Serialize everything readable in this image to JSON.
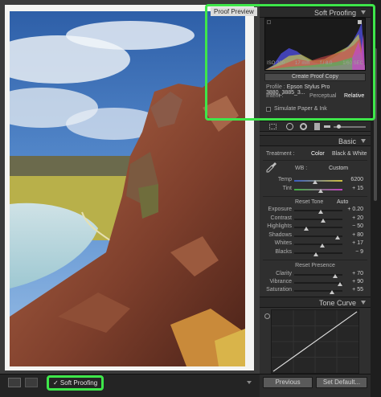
{
  "preview": {
    "proof_preview_label": "Proof Preview"
  },
  "soft_proofing_panel": {
    "title": "Soft Proofing",
    "histogram_info": {
      "iso": "ISO 200",
      "focal_length": "17 mm",
      "aperture": "f / 8.0",
      "shutter": "1/60 SEC"
    },
    "create_proof_copy": "Create Proof Copy",
    "profile_label": "Profile :",
    "profile_value": "Epson Stylus Pro 3880_3885_3...",
    "intent_label": "Intent :",
    "intent_options": [
      "Perceptual",
      "Relative"
    ],
    "intent_selected": "Relative",
    "simulate_label": "Simulate Paper & Ink"
  },
  "basic_panel": {
    "title": "Basic",
    "treatment_label": "Treatment :",
    "treatment_options": [
      "Color",
      "Black & White"
    ],
    "wb_label": "WB :",
    "wb_value": "Custom",
    "temp": {
      "label": "Temp",
      "value": "6200"
    },
    "tint": {
      "label": "Tint",
      "value": "+ 15"
    },
    "reset_tone_label": "Reset Tone",
    "auto_label": "Auto",
    "tone_rows": [
      {
        "label": "Exposure",
        "value": "+ 0.20",
        "level": 0.55
      },
      {
        "label": "Contrast",
        "value": "+ 20",
        "level": 0.6
      },
      {
        "label": "Highlights",
        "value": "− 50",
        "level": 0.25
      },
      {
        "label": "Shadows",
        "value": "+ 80",
        "level": 0.9
      },
      {
        "label": "Whites",
        "value": "+ 17",
        "level": 0.58
      },
      {
        "label": "Blacks",
        "value": "− 9",
        "level": 0.45
      }
    ],
    "reset_presence_label": "Reset Presence",
    "presence_rows": [
      {
        "label": "Clarity",
        "value": "+ 70",
        "level": 0.85
      },
      {
        "label": "Vibrance",
        "value": "+ 90",
        "level": 0.95
      },
      {
        "label": "Saturation",
        "value": "+ 55",
        "level": 0.78
      }
    ]
  },
  "tone_curve_panel": {
    "title": "Tone Curve"
  },
  "toolbar": {
    "soft_proofing_label": "✓ Soft Proofing"
  },
  "footer": {
    "previous_label": "Previous",
    "set_default_label": "Set Default..."
  },
  "colors": {
    "highlight": "#3ee64a"
  }
}
